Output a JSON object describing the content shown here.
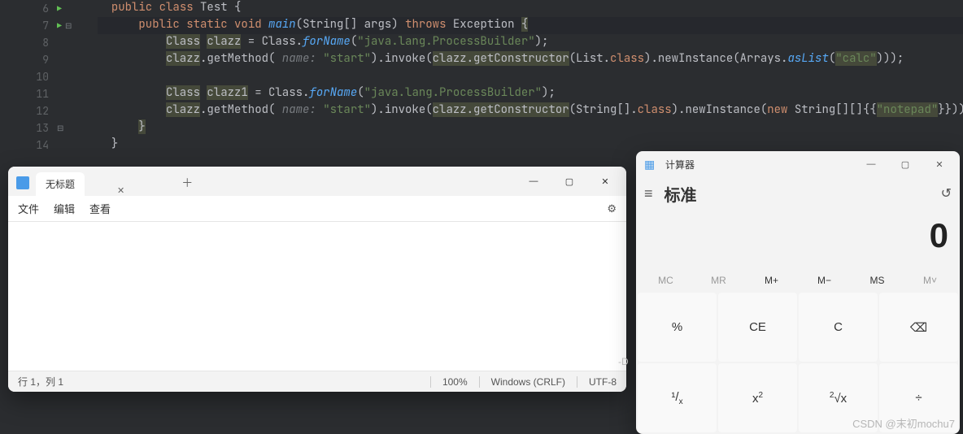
{
  "editor": {
    "lines": [
      {
        "num": 6,
        "run": true,
        "fold": false
      },
      {
        "num": 7,
        "run": true,
        "fold": true
      },
      {
        "num": 8,
        "run": false,
        "fold": false
      },
      {
        "num": 9,
        "run": false,
        "fold": false
      },
      {
        "num": 10,
        "run": false,
        "fold": false
      },
      {
        "num": 11,
        "run": false,
        "fold": false
      },
      {
        "num": 12,
        "run": false,
        "fold": false
      },
      {
        "num": 13,
        "run": false,
        "fold": true
      },
      {
        "num": 14,
        "run": false,
        "fold": false
      }
    ],
    "code": {
      "l6": {
        "k1": "public",
        "k2": "class",
        "name": "Test",
        "brace": "{"
      },
      "l7": {
        "k1": "public",
        "k2": "static",
        "k3": "void",
        "fn": "main",
        "params": "String[] args",
        "throws": "throws",
        "exc": "Exception",
        "brace": "{"
      },
      "l8": {
        "type": "Class",
        "var": "clazz",
        "eq": " = Class.",
        "fn": "forName",
        "str": "\"java.lang.ProcessBuilder\"",
        "end": ");"
      },
      "l9": {
        "var": "clazz",
        "m1": ".getMethod(",
        "pn": " name: ",
        "str1": "\"start\"",
        "m2": ").invoke(",
        "hl": "clazz.getConstructor",
        "m3": "(List.",
        "kw": "class",
        "m4": ").newInstance(Arrays.",
        "fn": "asList",
        "str2": "\"calc\"",
        "end": ")));"
      },
      "l11": {
        "type": "Class",
        "var": "clazz1",
        "eq": " = Class.",
        "fn": "forName",
        "str": "\"java.lang.ProcessBuilder\"",
        "end": ");"
      },
      "l12": {
        "var": "clazz",
        "m1": ".getMethod(",
        "pn": " name: ",
        "str1": "\"start\"",
        "m2": ").invoke(",
        "hl": "clazz.getConstructor",
        "m3": "(String[].",
        "kw": "class",
        "m4": ").newInstance(",
        "kw2": "new",
        "m5": " String[][]{{",
        "str2": "\"notepad\"",
        "end": "}}));"
      },
      "l13": {
        "brace": "}"
      },
      "l14": {
        "brace": "}"
      }
    }
  },
  "notepad": {
    "tab_title": "无标题",
    "menu": {
      "file": "文件",
      "edit": "编辑",
      "view": "查看"
    },
    "status": {
      "pos": "行 1，列 1",
      "zoom": "100%",
      "eol": "Windows (CRLF)",
      "enc": "UTF-8"
    }
  },
  "calc": {
    "title": "计算器",
    "mode": "标准",
    "display": "0",
    "mem": {
      "mc": "MC",
      "mr": "MR",
      "mplus": "M+",
      "mminus": "M−",
      "ms": "MS",
      "mv": "M˅"
    },
    "btns": {
      "percent": "%",
      "ce": "CE",
      "c": "C",
      "bksp": "⌫",
      "inv": "¹/ₓ",
      "sqr": "x²",
      "sqrt": "²√x",
      "div": "÷"
    }
  },
  "watermark": "CSDN @末初mochu7",
  "badge": "-D"
}
